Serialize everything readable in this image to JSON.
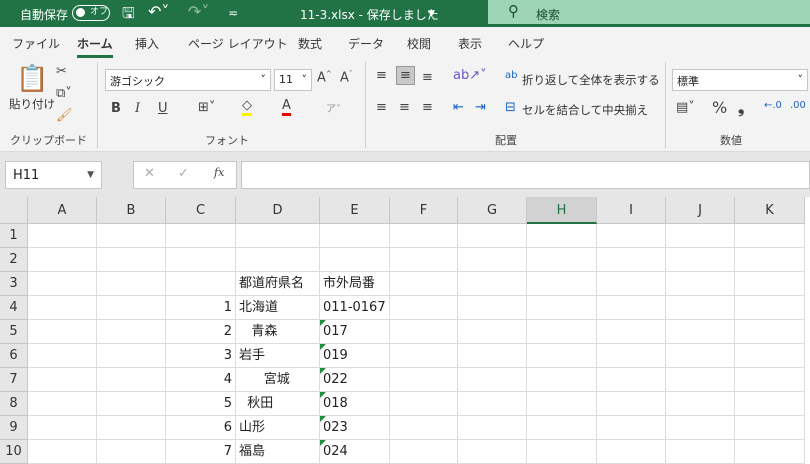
{
  "titlebar": {
    "autosave": "自動保存",
    "toggle": "オフ",
    "filename": "11-3.xlsx - 保存しました",
    "search": "検索"
  },
  "tabs": [
    "ファイル",
    "ホーム",
    "挿入",
    "ページ レイアウト",
    "数式",
    "データ",
    "校閲",
    "表示",
    "ヘルプ"
  ],
  "ribbon": {
    "paste": "貼り付け",
    "clipboard": "クリップボード",
    "font_name": "游ゴシック",
    "font_size": "11",
    "font_group": "フォント",
    "wrap": "折り返して全体を表示する",
    "merge": "セルを結合して中央揃え",
    "align_group": "配置",
    "number_format": "標準",
    "number_group": "数値",
    "bold": "B",
    "italic": "I",
    "underline": "U",
    "percent": "%",
    "comma": "❩"
  },
  "namebox": "H11",
  "formula": "",
  "columns": [
    "A",
    "B",
    "C",
    "D",
    "E",
    "F",
    "G",
    "H",
    "I",
    "J",
    "K"
  ],
  "selected_column": "H",
  "rows": [
    "1",
    "2",
    "3",
    "4",
    "5",
    "6",
    "7",
    "8",
    "9",
    "10"
  ],
  "cells": {
    "D3": "都道府県名",
    "E3": "市外局番",
    "C4": "1",
    "D4": "北海道",
    "E4": "011-0167",
    "C5": "2",
    "D5": "   青森",
    "E5": "017",
    "C6": "3",
    "D6": "岩手",
    "E6": "019",
    "C7": "4",
    "D7": "      宮城",
    "E7": "022",
    "C8": "5",
    "D8": "  秋田",
    "E8": "018",
    "C9": "6",
    "D9": "山形",
    "E9": "023",
    "C10": "7",
    "D10": "福島",
    "E10": "024"
  },
  "colors": {
    "brand": "#217346",
    "search_bg": "#9fd5b7"
  }
}
